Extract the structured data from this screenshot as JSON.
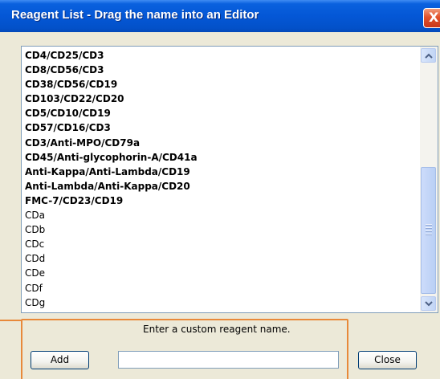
{
  "window": {
    "title": "Reagent List - Drag the name into an Editor",
    "close_glyph": "X"
  },
  "reagent_list": {
    "items": [
      {
        "label": "CD4/CD25/CD3",
        "bold": true
      },
      {
        "label": "CD8/CD56/CD3",
        "bold": true
      },
      {
        "label": "CD38/CD56/CD19",
        "bold": true
      },
      {
        "label": "CD103/CD22/CD20",
        "bold": true
      },
      {
        "label": "CD5/CD10/CD19",
        "bold": true
      },
      {
        "label": "CD57/CD16/CD3",
        "bold": true
      },
      {
        "label": "CD3/Anti-MPO/CD79a",
        "bold": true
      },
      {
        "label": "CD45/Anti-glycophorin-A/CD41a",
        "bold": true
      },
      {
        "label": "Anti-Kappa/Anti-Lambda/CD19",
        "bold": true
      },
      {
        "label": "Anti-Lambda/Anti-Kappa/CD20",
        "bold": true
      },
      {
        "label": "FMC-7/CD23/CD19",
        "bold": true
      },
      {
        "label": "CDa",
        "bold": false
      },
      {
        "label": "CDb",
        "bold": false
      },
      {
        "label": "CDc",
        "bold": false
      },
      {
        "label": "CDd",
        "bold": false
      },
      {
        "label": "CDe",
        "bold": false
      },
      {
        "label": "CDf",
        "bold": false
      },
      {
        "label": "CDg",
        "bold": false
      }
    ]
  },
  "custom": {
    "prompt": "Enter a custom reagent name.",
    "add_label": "Add",
    "input_value": "",
    "close_label": "Close"
  },
  "colors": {
    "titlebar": "#0457d6",
    "highlight_frame": "#e8893a",
    "dialog_bg": "#ece9d8"
  },
  "icons": {
    "close": "close-icon",
    "scroll_up": "chevron-up-icon",
    "scroll_down": "chevron-down-icon"
  }
}
